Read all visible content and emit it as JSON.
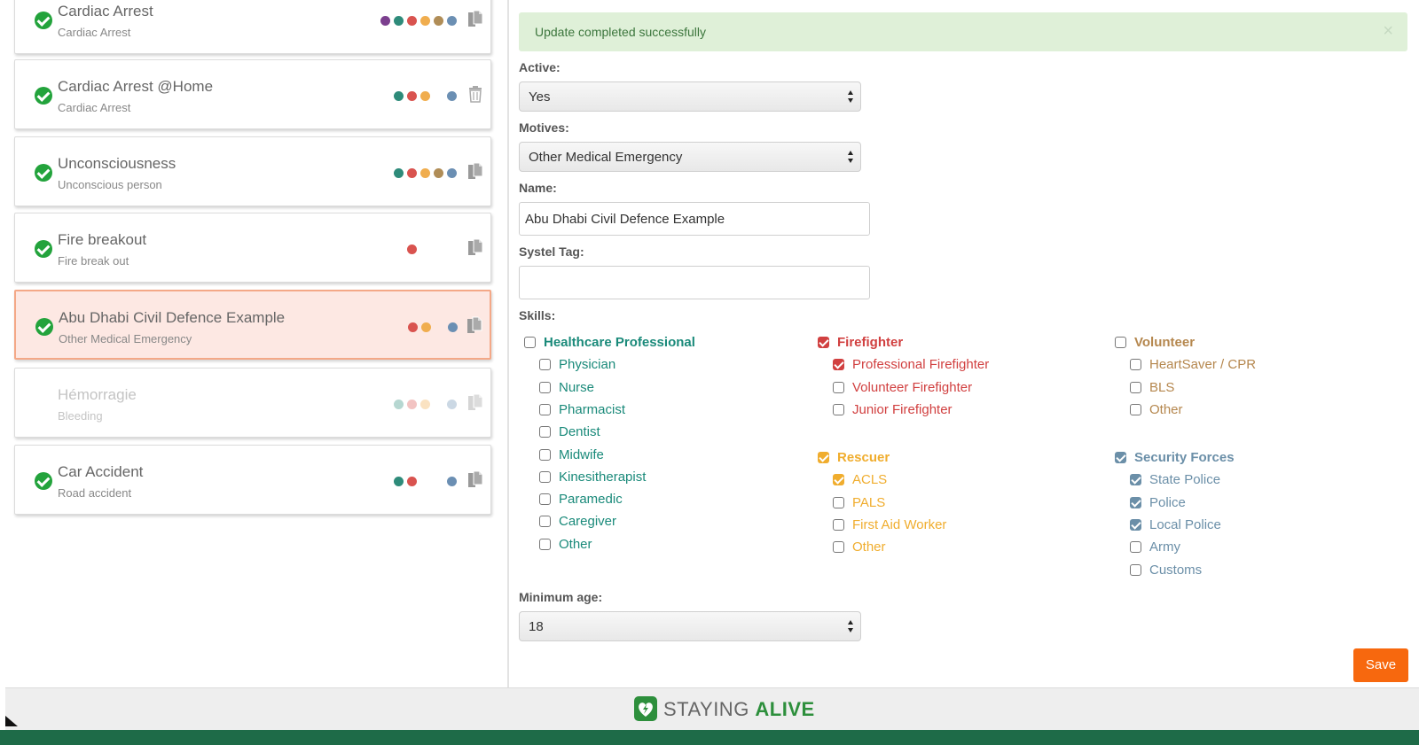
{
  "scenarios": [
    {
      "title": "Cardiac Arrest",
      "subtitle": "Cardiac Arrest",
      "dots": [
        "#7b3f8e",
        "#2e8b7a",
        "#d9534f",
        "#f0ad4e",
        "#b08d57",
        "#6b8fb3"
      ],
      "action": "copy"
    },
    {
      "title": "Cardiac Arrest @Home",
      "subtitle": "Cardiac Arrest",
      "dots": [
        "#2e8b7a",
        "#d9534f",
        "#f0ad4e",
        null,
        "#6b8fb3"
      ],
      "action": "trash"
    },
    {
      "title": "Unconsciousness",
      "subtitle": "Unconscious person",
      "dots": [
        "#2e8b7a",
        "#d9534f",
        "#f0ad4e",
        "#b08d57",
        "#6b8fb3"
      ],
      "action": "copy"
    },
    {
      "title": "Fire breakout",
      "subtitle": "Fire break out",
      "dots": [
        null,
        "#d9534f",
        null,
        null,
        null
      ],
      "action": "copy"
    },
    {
      "title": "Abu Dhabi Civil Defence Example",
      "subtitle": "Other Medical Emergency",
      "dots": [
        null,
        "#d9534f",
        "#f0ad4e",
        null,
        "#6b8fb3"
      ],
      "action": "copy",
      "selected": true
    },
    {
      "title": "Hémorragie",
      "subtitle": "Bleeding",
      "dots": [
        "#2e8b7a",
        "#d9534f",
        "#f0ad4e",
        null,
        "#6b8fb3"
      ],
      "action": "copy",
      "disabled": true
    },
    {
      "title": "Car Accident",
      "subtitle": "Road accident",
      "dots": [
        "#2e8b7a",
        "#d9534f",
        null,
        null,
        "#6b8fb3"
      ],
      "action": "copy"
    }
  ],
  "alert": {
    "message": "Update completed successfully",
    "close": "×"
  },
  "form": {
    "active_label": "Active:",
    "active_value": "Yes",
    "motives_label": "Motives:",
    "motives_value": "Other Medical Emergency",
    "name_label": "Name:",
    "name_value": "Abu Dhabi Civil Defence Example",
    "systel_label": "Systel Tag:",
    "systel_value": "",
    "skills_label": "Skills:",
    "min_age_label": "Minimum age:",
    "min_age_value": "18",
    "save_label": "Save"
  },
  "skills": [
    {
      "name": "Healthcare Professional",
      "color": "#1a8a7a",
      "checked": false,
      "items": [
        {
          "label": "Physician",
          "checked": false
        },
        {
          "label": "Nurse",
          "checked": false
        },
        {
          "label": "Pharmacist",
          "checked": false
        },
        {
          "label": "Dentist",
          "checked": false
        },
        {
          "label": "Midwife",
          "checked": false
        },
        {
          "label": "Kinesitherapist",
          "checked": false
        },
        {
          "label": "Paramedic",
          "checked": false
        },
        {
          "label": "Caregiver",
          "checked": false
        },
        {
          "label": "Other",
          "checked": false
        }
      ]
    },
    {
      "name": "Firefighter",
      "color": "#d14040",
      "checked": true,
      "items": [
        {
          "label": "Professional Firefighter",
          "checked": true
        },
        {
          "label": "Volunteer Firefighter",
          "checked": false
        },
        {
          "label": "Junior Firefighter",
          "checked": false
        }
      ]
    },
    {
      "name": "Rescuer",
      "color": "#f0ad2e",
      "checked": true,
      "items": [
        {
          "label": "ACLS",
          "checked": true
        },
        {
          "label": "PALS",
          "checked": false
        },
        {
          "label": "First Aid Worker",
          "checked": false
        },
        {
          "label": "Other",
          "checked": false
        }
      ]
    },
    {
      "name": "Volunteer",
      "color": "#b5874e",
      "checked": false,
      "items": [
        {
          "label": "HeartSaver / CPR",
          "checked": false
        },
        {
          "label": "BLS",
          "checked": false
        },
        {
          "label": "Other",
          "checked": false
        }
      ]
    },
    {
      "name": "Security Forces",
      "color": "#6b8fa8",
      "checked": true,
      "items": [
        {
          "label": "State Police",
          "checked": true
        },
        {
          "label": "Police",
          "checked": true
        },
        {
          "label": "Local Police",
          "checked": true
        },
        {
          "label": "Army",
          "checked": false
        },
        {
          "label": "Customs",
          "checked": false
        }
      ]
    }
  ],
  "footer": {
    "brand_part1": "STAYING ",
    "brand_part2": "ALIVE"
  },
  "colors": {
    "accent_save": "#f7680e",
    "success_bg": "#dff0d8",
    "brand_green": "#2d8f3c"
  },
  "icons": {
    "status": "check-circle-icon",
    "duplicate": "copy-icon",
    "delete": "trash-icon",
    "select": "select-arrows-icon",
    "logo": "heart-bolt-logo-icon"
  }
}
